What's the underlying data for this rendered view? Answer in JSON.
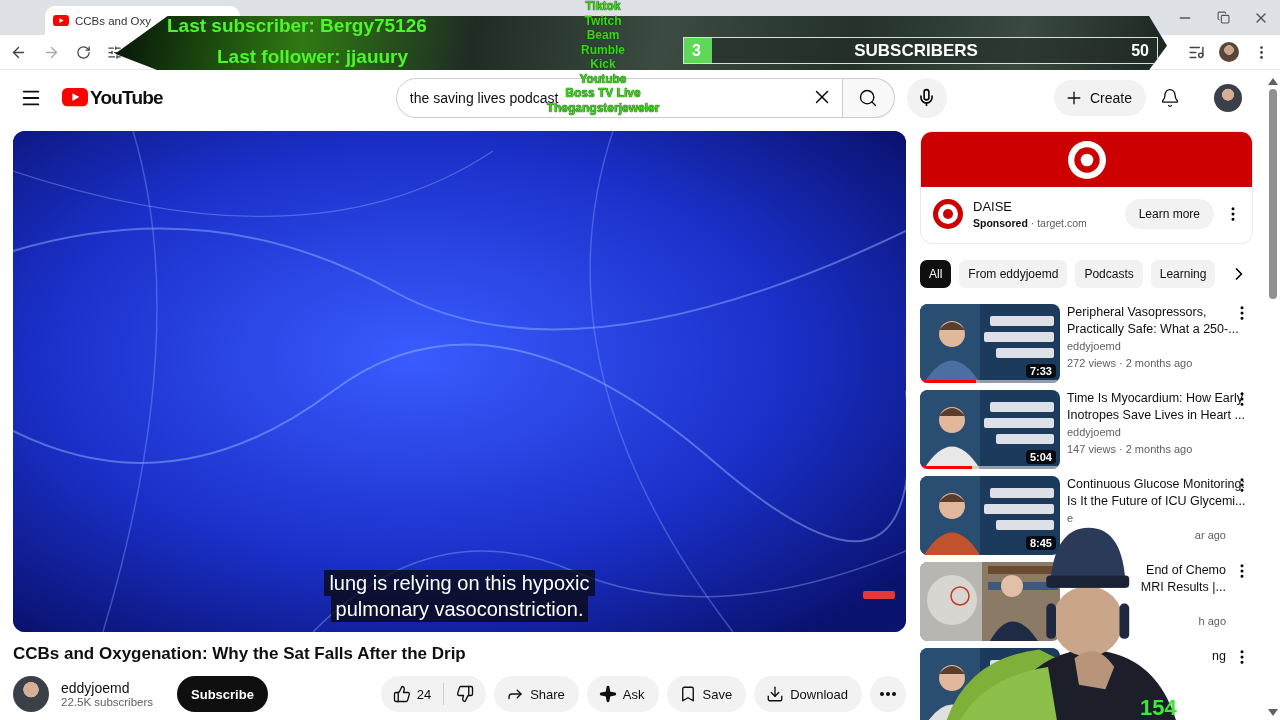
{
  "browser": {
    "tabs": [
      {
        "title": "CCBs and Oxy",
        "selected": true
      }
    ]
  },
  "stream_overlay": {
    "last_subscriber": "Last subscriber: Bergy75126",
    "last_follower": "Last follower: jjauury",
    "goal": {
      "current": "3",
      "label": "SUBSCRIBERS",
      "target": "50",
      "level": 0.06
    },
    "platforms": [
      "Tiktok",
      "Twitch",
      "Beam",
      "Rumble",
      "Kick",
      "Youtube",
      "Boss TV Live",
      "Thegangsterjeweler"
    ],
    "viewer_count": "154"
  },
  "header": {
    "logo": "YouTube",
    "search": {
      "value": "the saving lives podcast"
    },
    "create": "Create"
  },
  "player": {
    "captions": [
      "lung is relying on this hypoxic",
      "pulmonary vasoconstriction."
    ]
  },
  "video": {
    "title": "CCBs and Oxygenation: Why the Sat Falls After the Drip",
    "channel": "eddyjoemd",
    "subscribers": "22.5K subscribers",
    "subscribe": "Subscribe",
    "likes": "24",
    "actions": [
      {
        "kind": "share",
        "label": "Share"
      },
      {
        "kind": "ask",
        "label": "Ask"
      },
      {
        "kind": "save",
        "label": "Save"
      },
      {
        "kind": "download",
        "label": "Download"
      }
    ]
  },
  "ad": {
    "title": "DAISE",
    "byline": "**Sponsored** · target.com",
    "cta": "Learn more"
  },
  "chips": [
    {
      "label": "All",
      "selected": true
    },
    {
      "label": "From eddyjoemd",
      "selected": false
    },
    {
      "label": "Podcasts",
      "selected": false
    },
    {
      "label": "Learning",
      "selected": false
    }
  ],
  "recommendations": [
    {
      "kind": "full",
      "title": [
        "Peripheral Vasopressors,",
        "Practically Safe: What a 250-..."
      ],
      "channel": "eddyjoemd",
      "meta": "272 views · 2 months ago",
      "duration": "7:33",
      "level": 0.4
    },
    {
      "kind": "full",
      "title": [
        "Time Is Myocardium: How Early",
        "Inotropes Save Lives in Heart ..."
      ],
      "channel": "eddyjoemd",
      "meta": "147 views · 2 months ago",
      "duration": "5:04",
      "level": 0.37
    },
    {
      "kind": "partial",
      "title": [
        "Continuous Glucose Monitoring:",
        "Is It the Future of ICU Glycemi..."
      ],
      "channel": "e",
      "meta": "ar ago",
      "duration": "8:45"
    },
    {
      "kind": "covered",
      "title": [
        "End of Chemo",
        "MRI Results |..."
      ],
      "meta": "h ago"
    },
    {
      "kind": "covered",
      "title": [
        "ng"
      ]
    }
  ]
}
